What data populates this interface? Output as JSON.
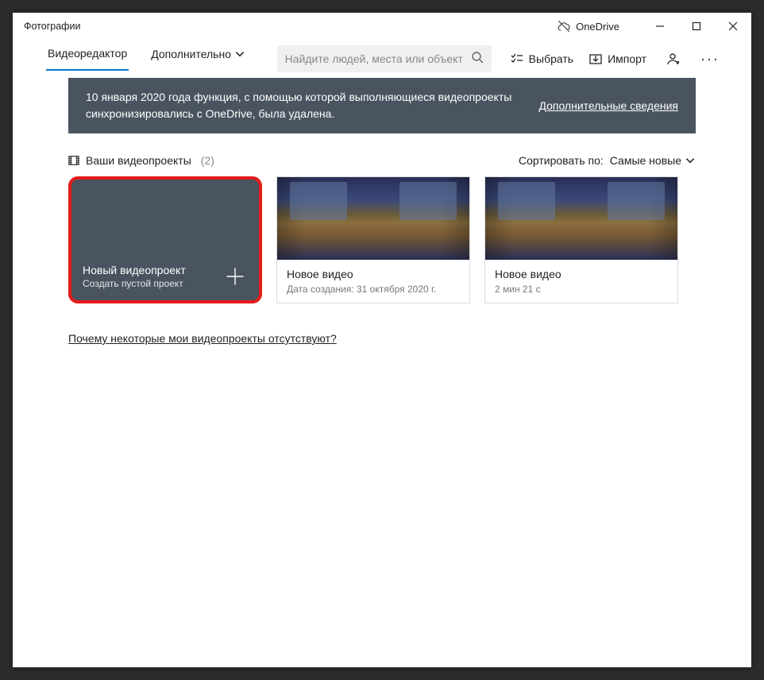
{
  "titlebar": {
    "title": "Фотографии",
    "onedrive_label": "OneDrive"
  },
  "toolbar": {
    "tabs": {
      "active": "Видеоредактор",
      "more": "Дополнительно"
    },
    "search_placeholder": "Найдите людей, места или объект",
    "select_label": "Выбрать",
    "import_label": "Импорт"
  },
  "banner": {
    "text": "10 января 2020 года функция, с помощью которой выполняющиеся видеопроекты синхронизировались с OneDrive, была удалена.",
    "link": "Дополнительные сведения"
  },
  "section": {
    "title": "Ваши видеопроекты",
    "count": "(2)",
    "sort_label": "Сортировать по:",
    "sort_value": "Самые новые"
  },
  "new_card": {
    "title": "Новый видеопроект",
    "subtitle": "Создать пустой проект"
  },
  "projects": [
    {
      "title": "Новое видео",
      "subtitle": "Дата создания: 31 октября 2020 г."
    },
    {
      "title": "Новое видео",
      "subtitle": "2 мин 21 с"
    }
  ],
  "faq_link": "Почему некоторые мои видеопроекты отсутствуют?"
}
